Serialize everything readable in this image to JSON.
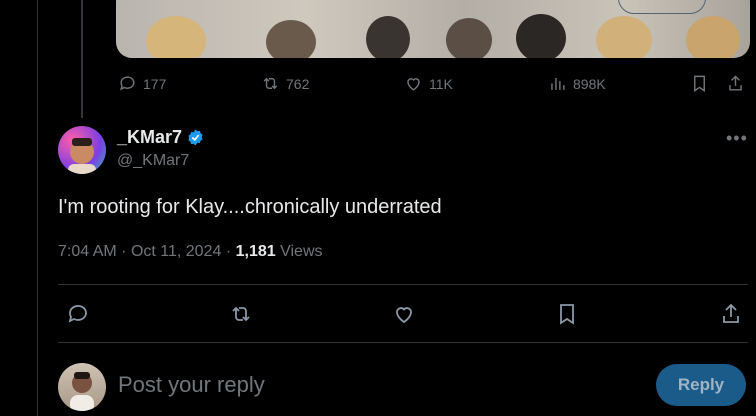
{
  "parent": {
    "stats": {
      "replies": "177",
      "reposts": "762",
      "likes": "11K",
      "views": "898K"
    }
  },
  "tweet": {
    "display_name": "_KMar7",
    "handle": "@_KMar7",
    "text": "I'm rooting for Klay....chronically underrated",
    "time": "7:04 AM",
    "date": "Oct 11, 2024",
    "views_count": "1,181",
    "views_label": "Views"
  },
  "reply_box": {
    "placeholder": "Post your reply",
    "button_label": "Reply"
  },
  "colors": {
    "verified": "#1d9bf0",
    "reply_button_bg": "#1a5b8a",
    "muted_text": "#71767b"
  },
  "icons": {
    "reply": "reply-icon",
    "repost": "repost-icon",
    "like": "heart-icon",
    "views": "views-icon",
    "bookmark": "bookmark-icon",
    "share": "share-icon",
    "more": "more-icon",
    "verified": "verified-badge-icon"
  }
}
